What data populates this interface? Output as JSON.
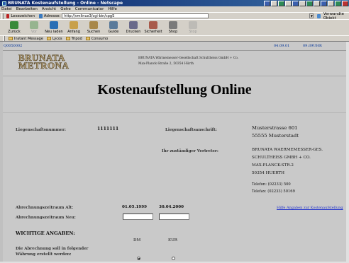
{
  "window": {
    "title": "BRUNATA Kostenaufstellung - Online - Netscape"
  },
  "menu": [
    "Datei",
    "Bearbeiten",
    "Ansicht",
    "Gehe",
    "Communicator",
    "Hilfe"
  ],
  "location": {
    "bookmarks_label": "Lesezeichen",
    "address_label": "Adresse:",
    "url": "http://vmlinux3/cgi-bin/cpgS",
    "related_label": "Verwandte Objekt"
  },
  "navigation": [
    {
      "label": "Zurück",
      "icon": "back-arrow-icon",
      "color": "#3a8a3a",
      "enabled": true
    },
    {
      "label": "Vor",
      "icon": "forward-arrow-icon",
      "color": "#3a8a3a",
      "enabled": false
    },
    {
      "label": "Neu laden",
      "icon": "reload-icon",
      "color": "#2a6fb5",
      "enabled": true
    },
    {
      "label": "Anfang",
      "icon": "home-icon",
      "color": "#c8a04a",
      "enabled": true
    },
    {
      "label": "Suchen",
      "icon": "search-icon",
      "color": "#a8884a",
      "enabled": true
    },
    {
      "label": "Guide",
      "icon": "guide-icon",
      "color": "#5a7a9a",
      "enabled": true
    },
    {
      "label": "Drucken",
      "icon": "print-icon",
      "color": "#6a6a8a",
      "enabled": true
    },
    {
      "label": "Sicherheit",
      "icon": "lock-icon",
      "color": "#a85a4a",
      "enabled": true
    },
    {
      "label": "Shop",
      "icon": "shop-icon",
      "color": "#7a7a7a",
      "enabled": true
    },
    {
      "label": "Stop",
      "icon": "stop-icon",
      "color": "#9a9a9a",
      "enabled": false
    }
  ],
  "personal_toolbar": [
    "Instant Message",
    "Lycos",
    "Tripod",
    "Consumo"
  ],
  "page": {
    "id": "Q0050002",
    "date": "04.09.01",
    "time": "09:39UHR",
    "logo_line1": "BRUNATA",
    "logo_line2": "METRONA",
    "company_line1": "BRUNATA Wärmemesser-Gesellschaft Schultheiss GmbH + Co.",
    "company_line2": "Max-Planck-Straße 2, 50354 Hürth",
    "title": "Kostenaufstellung Online",
    "property_number_label": "Liegenschaftsnummer:",
    "property_number": "1111111",
    "property_address_label": "Liegenschaftsanschrift:",
    "property_address": [
      "Musterstrasse 601",
      "55555 Musterstadt"
    ],
    "rep_label": "Ihr zuständiger Vertreter:",
    "rep_address": [
      "BRUNATA WAERMEMESSER-GES.",
      "SCHULTHEISS GMBH + CO.",
      "MAX-PLANCK-STR.2",
      "50354 HUERTH"
    ],
    "phone": "Telefon: (02233) 500",
    "fax": "Telefax: (02233) 50169",
    "help_link": "Hilfe Angaben zur Kostenaufstellung",
    "period_old_label": "Abrechnungszeitraum Alt:",
    "period_old_from": "01.05.1999",
    "period_old_to": "30.04.2000",
    "period_new_label": "Abrechnungszeitraum Neu:",
    "important_label": "WICHTIGE ANGABEN:",
    "currency_col_dm": "DM",
    "currency_col_eur": "EUR",
    "currency_question": "Die Abrechnung soll in folgender Währung erstellt werden:",
    "currency_selected": "DM"
  }
}
